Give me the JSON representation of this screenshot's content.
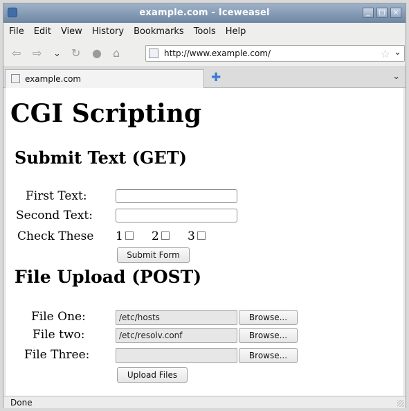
{
  "window": {
    "title": "example.com - Iceweasel"
  },
  "menu": [
    "File",
    "Edit",
    "View",
    "History",
    "Bookmarks",
    "Tools",
    "Help"
  ],
  "navigation": {
    "url": "http://www.example.com/"
  },
  "tab": {
    "label": "example.com"
  },
  "page": {
    "title": "CGI Scripting",
    "get_section": {
      "heading": "Submit Text (GET)",
      "first_label": "First Text:",
      "first_value": "",
      "second_label": "Second Text:",
      "second_value": "",
      "check_label": "Check These",
      "checkboxes": [
        "1",
        "2",
        "3"
      ],
      "submit_label": "Submit Form"
    },
    "post_section": {
      "heading": "File Upload (POST)",
      "file_one_label": "File One:",
      "file_one_value": "/etc/hosts",
      "file_two_label": "File two:",
      "file_two_value": "/etc/resolv.conf",
      "file_three_label": "File Three:",
      "file_three_value": "",
      "browse_label": "Browse...",
      "upload_label": "Upload Files"
    }
  },
  "status": {
    "text": "Done"
  }
}
